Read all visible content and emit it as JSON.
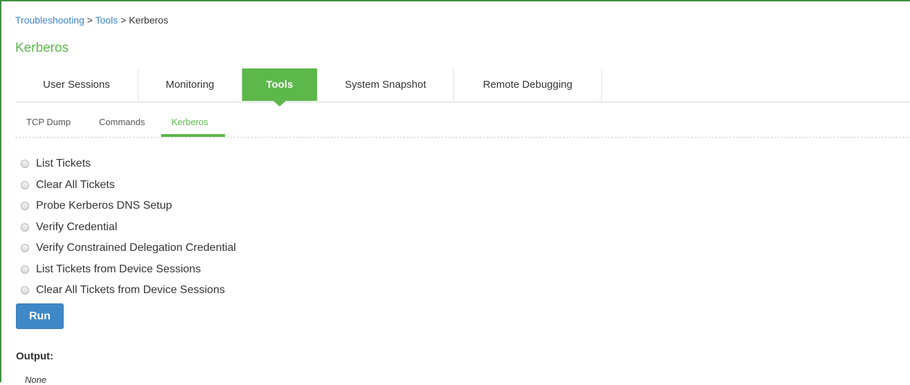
{
  "breadcrumb": {
    "items": [
      "Troubleshooting",
      "Tools",
      "Kerberos"
    ],
    "separator": ">"
  },
  "page_title": "Kerberos",
  "tabs": [
    {
      "label": "User Sessions",
      "active": false
    },
    {
      "label": "Monitoring",
      "active": false
    },
    {
      "label": "Tools",
      "active": true
    },
    {
      "label": "System Snapshot",
      "active": false
    },
    {
      "label": "Remote Debugging",
      "active": false
    }
  ],
  "subtabs": [
    {
      "label": "TCP Dump",
      "active": false
    },
    {
      "label": "Commands",
      "active": false
    },
    {
      "label": "Kerberos",
      "active": true
    }
  ],
  "options": [
    {
      "label": "List Tickets",
      "selected": false
    },
    {
      "label": "Clear All Tickets",
      "selected": false
    },
    {
      "label": "Probe Kerberos DNS Setup",
      "selected": false
    },
    {
      "label": "Verify Credential",
      "selected": false
    },
    {
      "label": "Verify Constrained Delegation Credential",
      "selected": false
    },
    {
      "label": "List Tickets from Device Sessions",
      "selected": false
    },
    {
      "label": "Clear All Tickets from Device Sessions",
      "selected": false
    }
  ],
  "run_button": "Run",
  "output": {
    "label": "Output:",
    "value": "None"
  },
  "colors": {
    "accent_green": "#5cb84b",
    "link_blue": "#3a84c8",
    "button_blue": "#3f88c8"
  }
}
